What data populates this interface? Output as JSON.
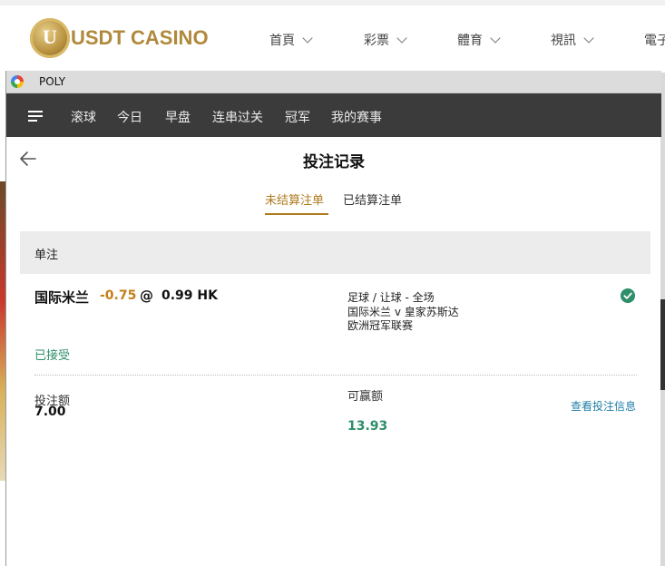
{
  "site": {
    "logo_letter": "U",
    "brand": "USDT CASINO",
    "nav": [
      "首頁",
      "彩票",
      "體育",
      "視訊",
      "電子"
    ]
  },
  "window": {
    "title": "POLY"
  },
  "app_nav": {
    "tabs": [
      "滚球",
      "今日",
      "早盘",
      "连串过关",
      "冠军",
      "我的赛事"
    ]
  },
  "page": {
    "title": "投注记录",
    "tabs": {
      "pending": "未结算注单",
      "settled": "已结算注单"
    },
    "active_tab": "pending"
  },
  "section": {
    "label": "单注"
  },
  "bet": {
    "selection": "国际米兰",
    "handicap": "-0.75",
    "at": "@",
    "odds": "0.99 HK",
    "market": "足球 / 让球 - 全场",
    "matchup": "国际米兰 v 皇家苏斯达",
    "league": "欧洲冠军联赛",
    "status": "已接受",
    "stake_label": "投注额",
    "stake": "7.00",
    "win_label": "可赢额",
    "win_amount": "13.93",
    "details_link": "查看投注信息"
  },
  "colors": {
    "accent_gold": "#b07b1e",
    "handicap_orange": "#c47e1a",
    "success_green": "#2f8f6a",
    "link_blue": "#1f7fa6",
    "nav_dark": "#3b3b3b"
  }
}
